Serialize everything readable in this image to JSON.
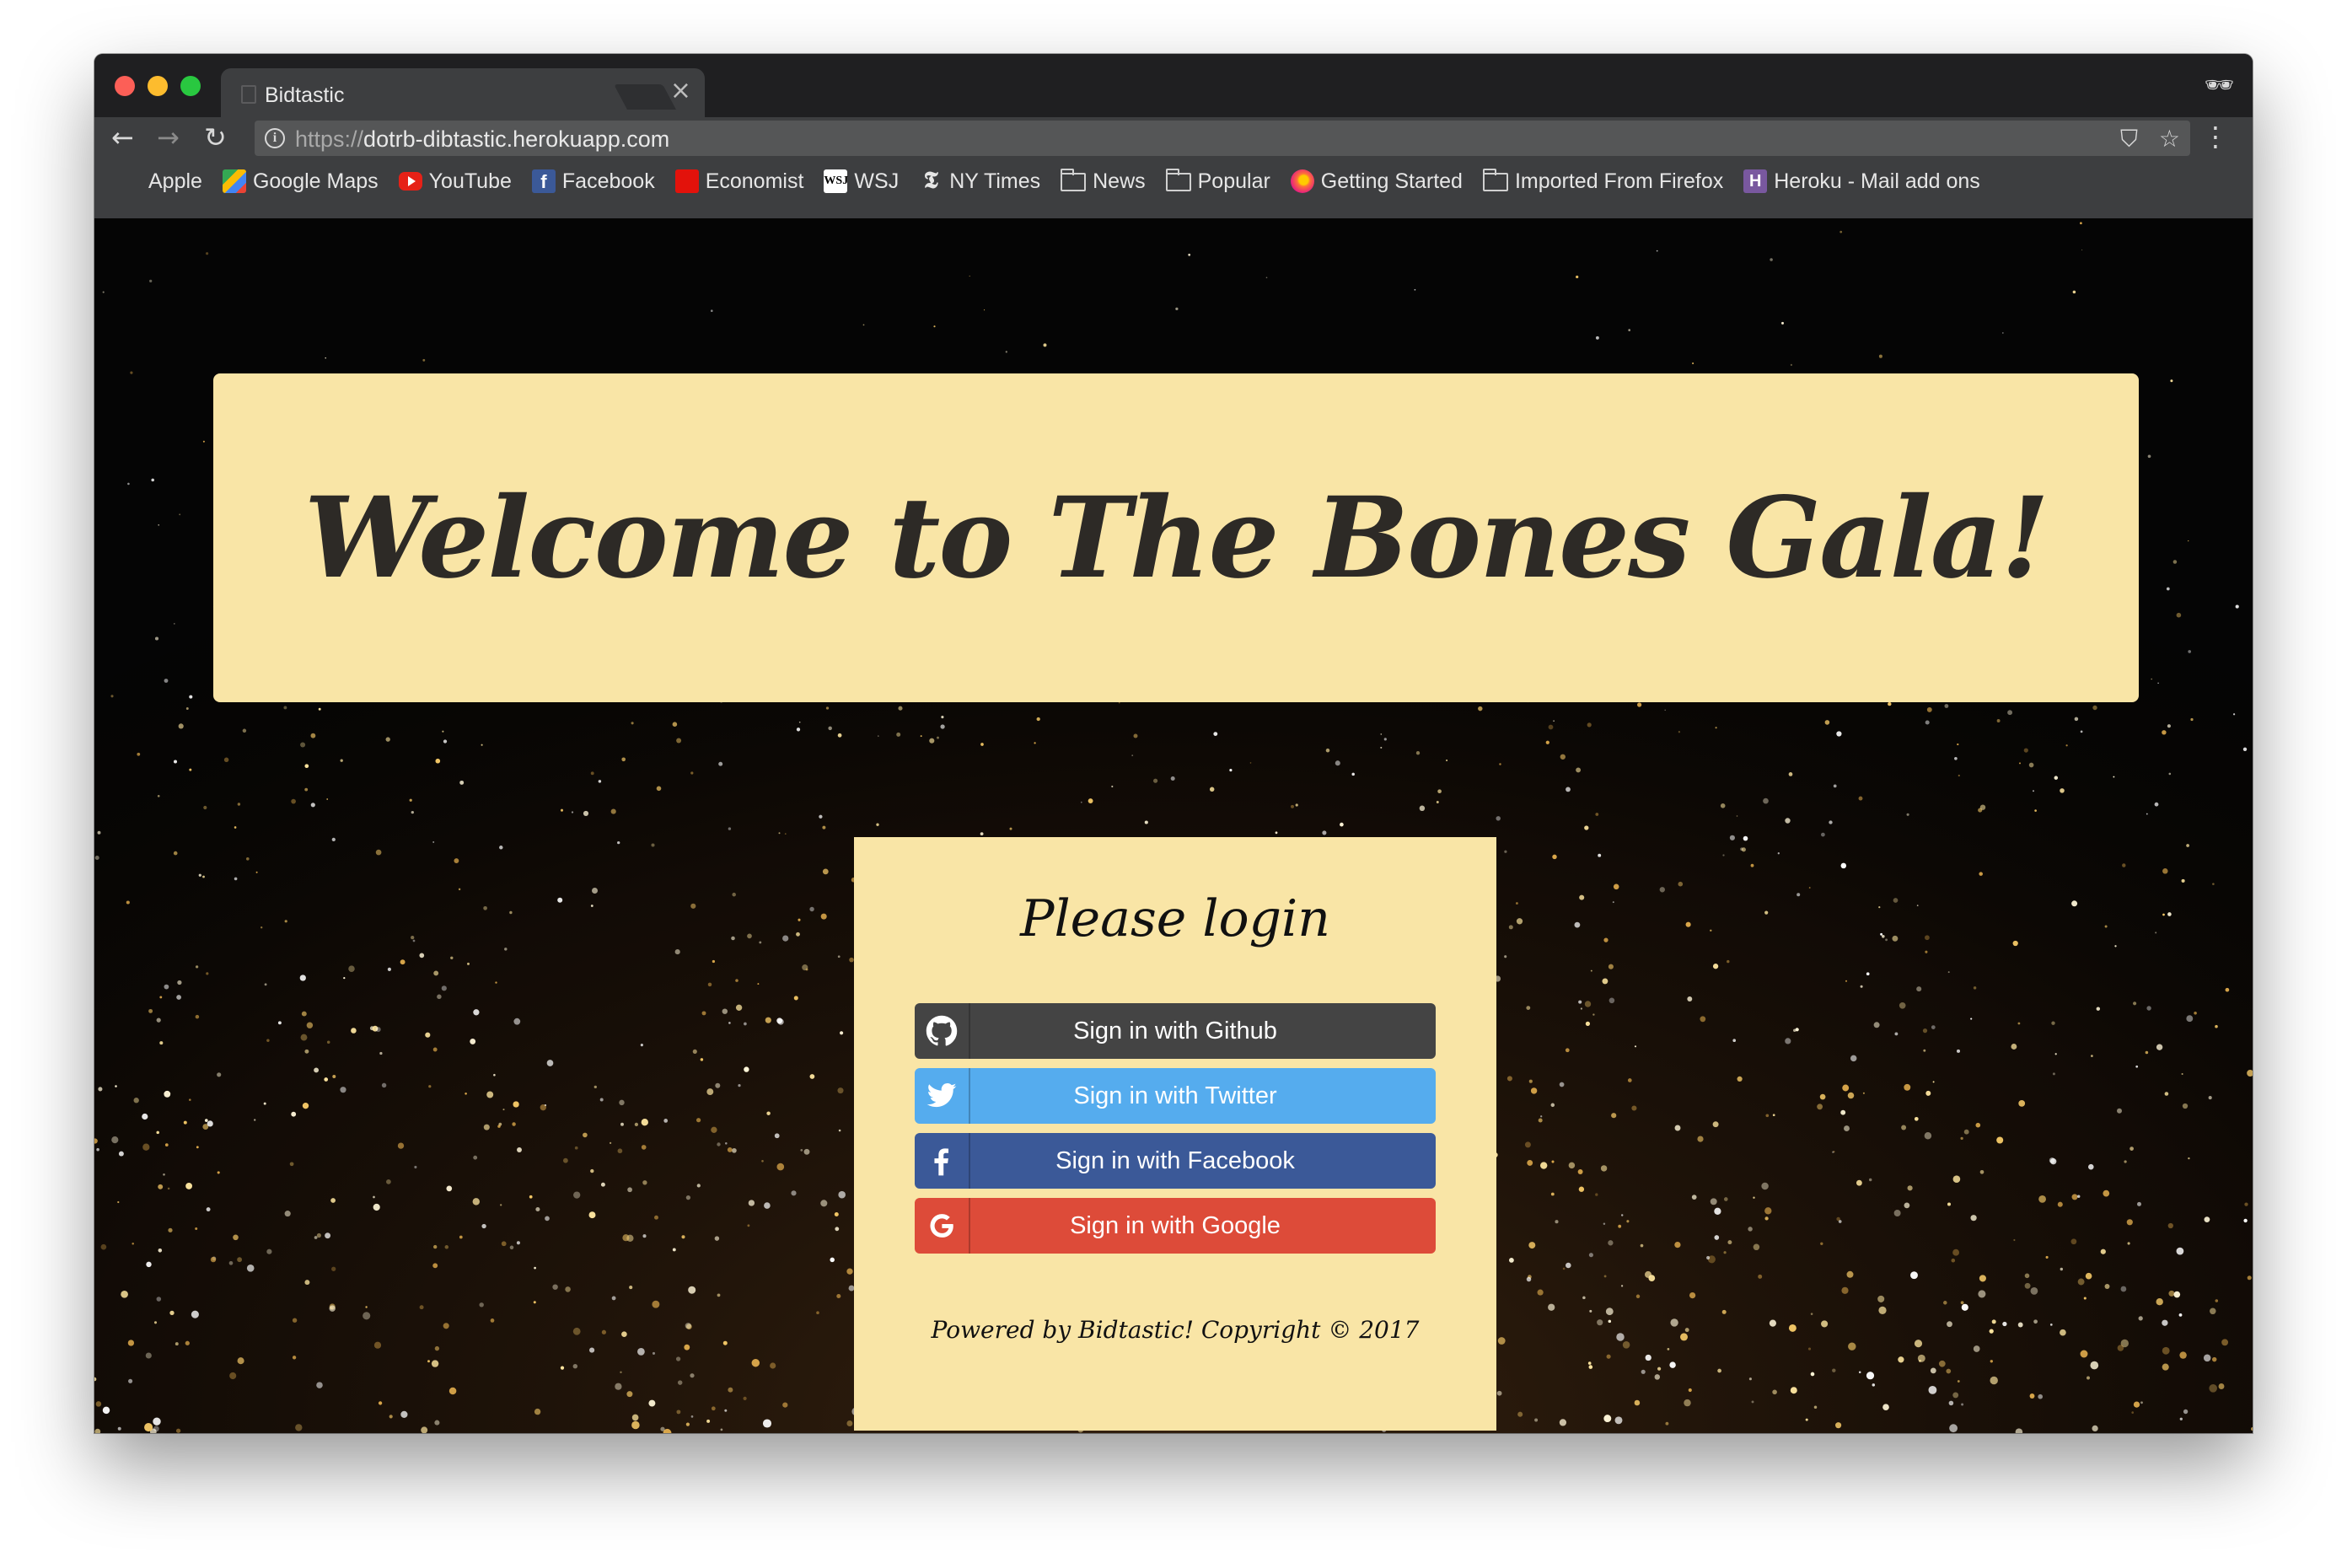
{
  "browser": {
    "tab_title": "Bidtastic",
    "tab_close": "×",
    "url_scheme": "https://",
    "url_host": "dotrb-dibtastic.herokuapp.com",
    "bookmarks": [
      {
        "label": "Apple",
        "icon": "apple-icon"
      },
      {
        "label": "Google Maps",
        "icon": "google-maps-icon"
      },
      {
        "label": "YouTube",
        "icon": "youtube-icon"
      },
      {
        "label": "Facebook",
        "icon": "facebook-icon"
      },
      {
        "label": "Economist",
        "icon": "economist-icon"
      },
      {
        "label": "WSJ",
        "icon": "wsj-icon"
      },
      {
        "label": "NY Times",
        "icon": "nytimes-icon"
      },
      {
        "label": "News",
        "icon": "folder-icon"
      },
      {
        "label": "Popular",
        "icon": "folder-icon"
      },
      {
        "label": "Getting Started",
        "icon": "firefox-icon"
      },
      {
        "label": "Imported From Firefox",
        "icon": "folder-icon"
      },
      {
        "label": "Heroku - Mail add ons",
        "icon": "heroku-icon"
      }
    ]
  },
  "page": {
    "hero_title": "Welcome to The Bones Gala!",
    "login": {
      "title": "Please login",
      "buttons": [
        {
          "label": "Sign in with Github",
          "icon": "github-icon",
          "color": "#444444"
        },
        {
          "label": "Sign in with Twitter",
          "icon": "twitter-icon",
          "color": "#55acee"
        },
        {
          "label": "Sign in with Facebook",
          "icon": "facebook-icon",
          "color": "#3b5998"
        },
        {
          "label": "Sign in with Google",
          "icon": "google-icon",
          "color": "#dd4b39"
        }
      ],
      "footer": "Powered by Bidtastic! Copyright © 2017"
    }
  },
  "colors": {
    "panel_background": "#f9e5a6",
    "page_background": "#050505"
  }
}
